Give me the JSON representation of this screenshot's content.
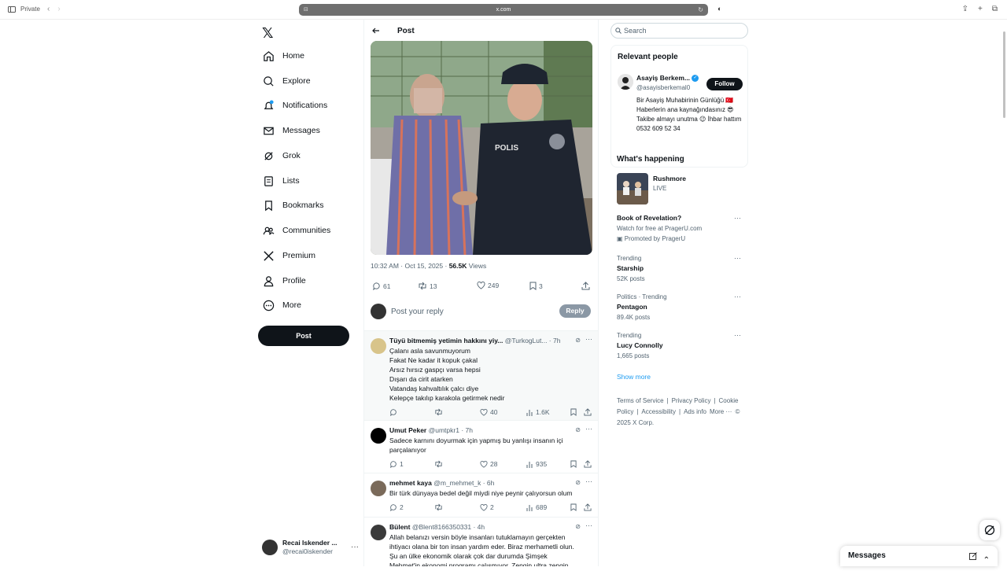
{
  "browser": {
    "private_label": "Private",
    "url": "x.com"
  },
  "nav": {
    "items": [
      {
        "label": "Home",
        "icon": "home-icon"
      },
      {
        "label": "Explore",
        "icon": "search-icon"
      },
      {
        "label": "Notifications",
        "icon": "bell-icon"
      },
      {
        "label": "Messages",
        "icon": "mail-icon"
      },
      {
        "label": "Grok",
        "icon": "grok-icon"
      },
      {
        "label": "Lists",
        "icon": "list-icon"
      },
      {
        "label": "Bookmarks",
        "icon": "bookmark-icon"
      },
      {
        "label": "Communities",
        "icon": "people-icon"
      },
      {
        "label": "Premium",
        "icon": "x-logo-icon"
      },
      {
        "label": "Profile",
        "icon": "person-icon"
      },
      {
        "label": "More",
        "icon": "more-circle-icon"
      }
    ],
    "post_button": "Post",
    "account": {
      "name": "Recai Iskender ...",
      "handle": "@recai0iskender"
    }
  },
  "main": {
    "header": "Post",
    "image_text": "POLIS",
    "meta": {
      "time": "10:32 AM · Oct 15, 2025 · ",
      "views": "56.5K",
      "views_label": " Views"
    },
    "stats": {
      "replies": "61",
      "reposts": "13",
      "likes": "249",
      "bookmarks": "3"
    },
    "reply_placeholder": "Post your reply",
    "reply_button": "Reply",
    "replies": [
      {
        "name": "Tüyü bitmemiş yetimin hakkını yiy...",
        "handle": "@TurkogLut... · 7h",
        "lines": [
          "Çalanı asla savunmuyorum",
          "Fakat Ne kadar it kopuk çakal",
          "Arsız hırsız gaspçı varsa hepsi",
          "Dışarı da cirit atarken",
          "Vatandaş kahvaltılık çalcı diye",
          "Kelepçe takılıp karakola getirmek nedir"
        ],
        "replies": "",
        "reposts": "",
        "likes": "40",
        "views": "1.6K"
      },
      {
        "name": "Umut Peker",
        "handle": "@umtpkr1 · 7h",
        "lines": [
          "Sadece karnını doyurmak için yapmış bu yanlışı insanın içi",
          "parçalanıyor"
        ],
        "replies": "1",
        "reposts": "",
        "likes": "28",
        "views": "935"
      },
      {
        "name": "mehmet kaya",
        "handle": "@m_mehmet_k · 6h",
        "lines": [
          "Bir türk dünyaya bedel değil miydi niye peynir çalıyorsun olum"
        ],
        "replies": "2",
        "reposts": "",
        "likes": "2",
        "views": "689"
      },
      {
        "name": "Bülent",
        "handle": "@Blent8166350331 · 4h",
        "lines": [
          "Allah belanızı versin böyle insanları tutuklamayın gerçekten",
          "ihtiyacı olana bir ton insan yardım eder. Biraz merhametli olun.",
          "Şu an ülke ekonomik olarak çok dar durumda Şimşek",
          "Mehmet'in ekonomi programı çalışmıyor. Zengin ultra zengin"
        ],
        "replies": "",
        "reposts": "",
        "likes": "",
        "views": ""
      }
    ]
  },
  "right": {
    "search_placeholder": "Search",
    "relevant": {
      "title": "Relevant people",
      "name": "Asayiş Berkem...",
      "handle": "@asayisberkemal0",
      "follow": "Follow",
      "bio": "Bir Asayiş Muhabirinin Günlüğü 🇹🇷 Haberlerin ana kaynağındasınız 😎 Takibe almayı unutma 😉 İhbar hattım 0532 609 52 34"
    },
    "happening": {
      "title": "What's happening",
      "live": {
        "title": "Rushmore",
        "status": "LIVE"
      },
      "trends": [
        {
          "cat": "",
          "title": "Book of Revelation?",
          "sub": "Watch for free at PragerU.com",
          "extra": "Promoted by PragerU"
        },
        {
          "cat": "Trending",
          "title": "Starship",
          "sub": "52K posts",
          "extra": ""
        },
        {
          "cat": "Politics · Trending",
          "title": "Pentagon",
          "sub": "89.4K posts",
          "extra": ""
        },
        {
          "cat": "Trending",
          "title": "Lucy Connolly",
          "sub": "1,665 posts",
          "extra": ""
        }
      ],
      "show_more": "Show more"
    },
    "footer": [
      "Terms of Service",
      "|",
      "Privacy Policy",
      "|",
      "Cookie Policy",
      "|",
      "Accessibility",
      "|",
      "Ads info",
      "More ···",
      "© 2025 X Corp."
    ]
  },
  "messages_drawer": {
    "title": "Messages"
  },
  "colors": {
    "accent": "#1d9bf0",
    "text": "#0f1419",
    "muted": "#536471"
  }
}
